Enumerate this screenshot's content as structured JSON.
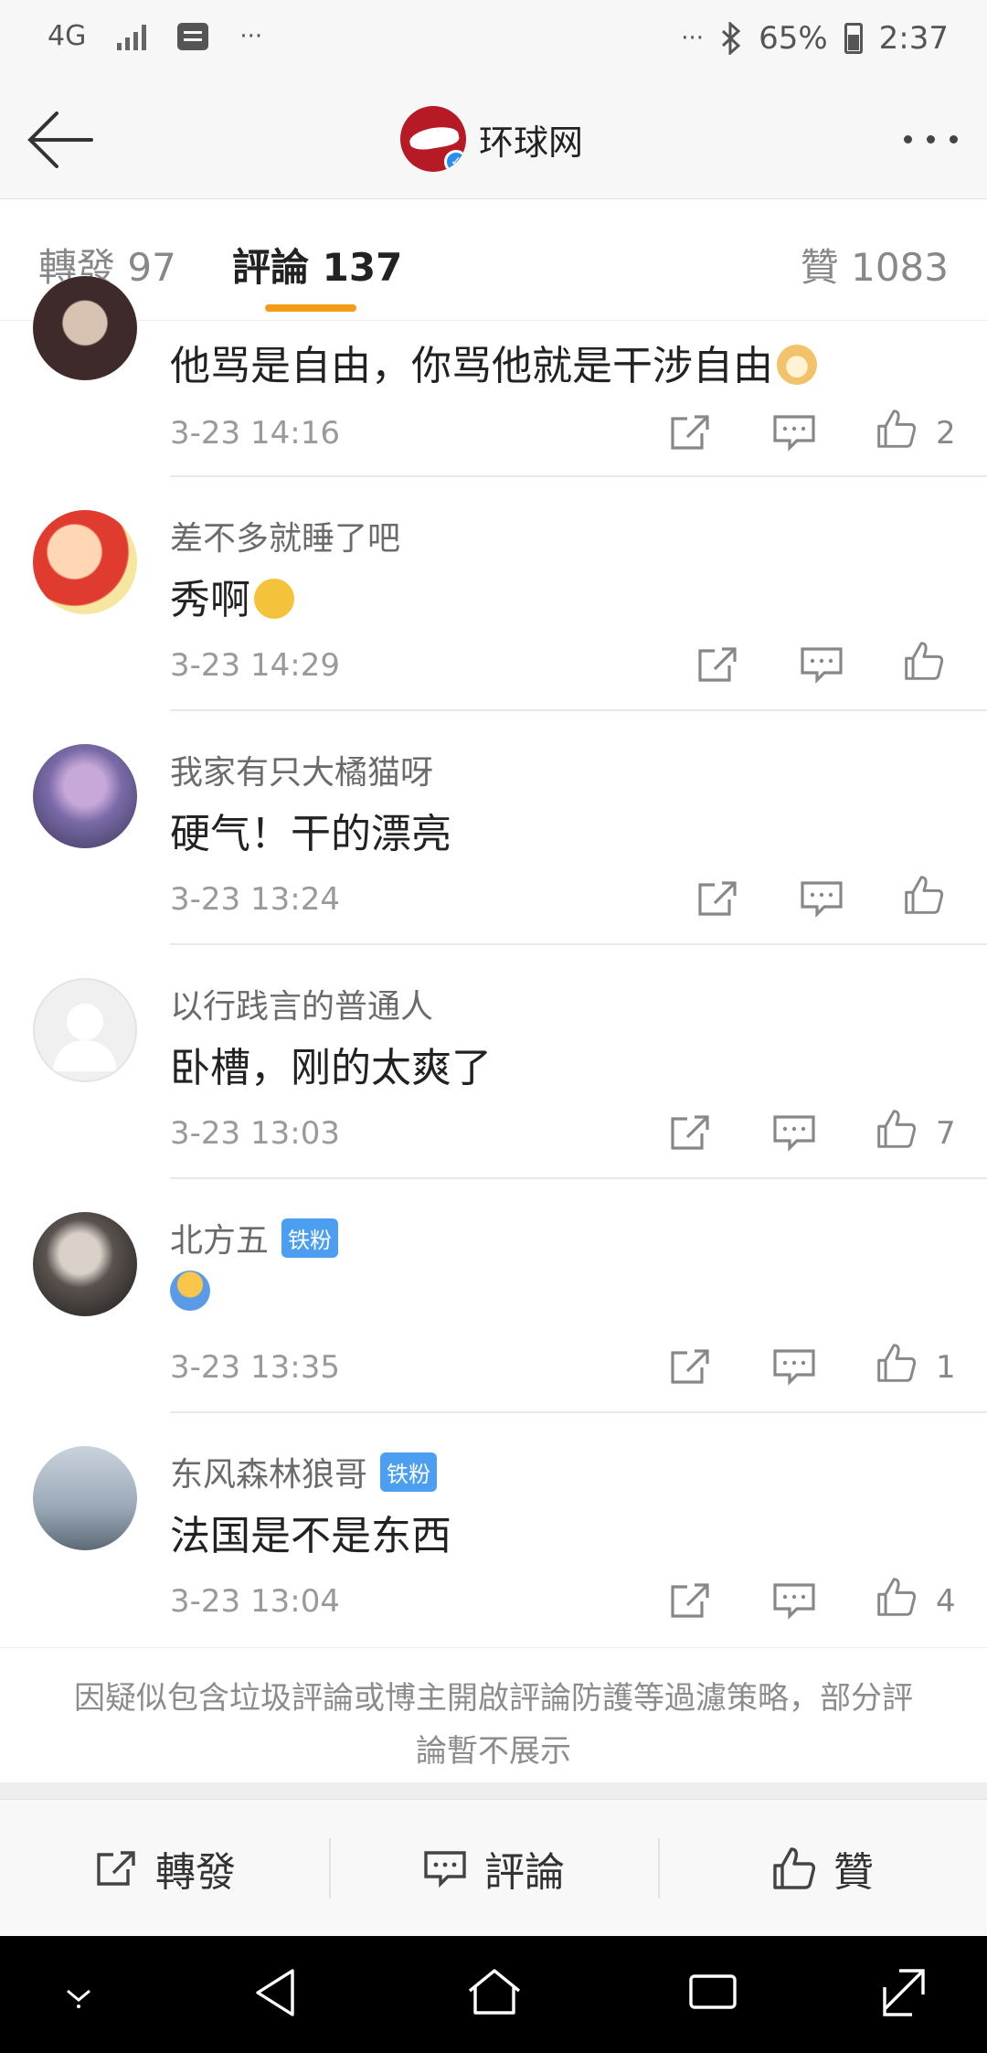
{
  "status_bar": {
    "network": "4G",
    "dots_left": "···",
    "dots_right": "···",
    "battery": "65%",
    "time": "2:37"
  },
  "header": {
    "account_name": "环球网"
  },
  "tabs": [
    {
      "label": "轉發 97"
    },
    {
      "label": "評論 137",
      "active": true
    },
    {
      "label": "贊 1083"
    }
  ],
  "comments": [
    {
      "username": "",
      "text": "他骂是自由，你骂他就是干涉自由",
      "time": "3-23 14:16",
      "likes": "2",
      "emoji": "dog-emoji"
    },
    {
      "username": "差不多就睡了吧",
      "text": "秀啊",
      "time": "3-23 14:29",
      "likes": "",
      "emoji": "sleepy-emoji"
    },
    {
      "username": "我家有只大橘猫呀",
      "text": "硬气！干的漂亮",
      "time": "3-23 13:24",
      "likes": ""
    },
    {
      "username": "以行践言的普通人",
      "text": "卧槽，刚的太爽了",
      "time": "3-23 13:03",
      "likes": "7"
    },
    {
      "username": "北方五",
      "badge": "铁粉",
      "text": "",
      "time": "3-23 13:35",
      "likes": "1",
      "emoji": "shrug-emoji"
    },
    {
      "username": "东风森林狼哥",
      "badge": "铁粉",
      "text": "法国是不是东西",
      "time": "3-23 13:04",
      "likes": "4"
    }
  ],
  "notice": "因疑似包含垃圾評論或博主開啟評論防護等過濾策略，部分評論暫不展示",
  "toolbar": {
    "repost": "轉發",
    "comment": "評論",
    "like": "贊"
  },
  "colors": {
    "accent": "#f49b17",
    "badge": "#4b9ef0",
    "brand": "#b51a25"
  }
}
